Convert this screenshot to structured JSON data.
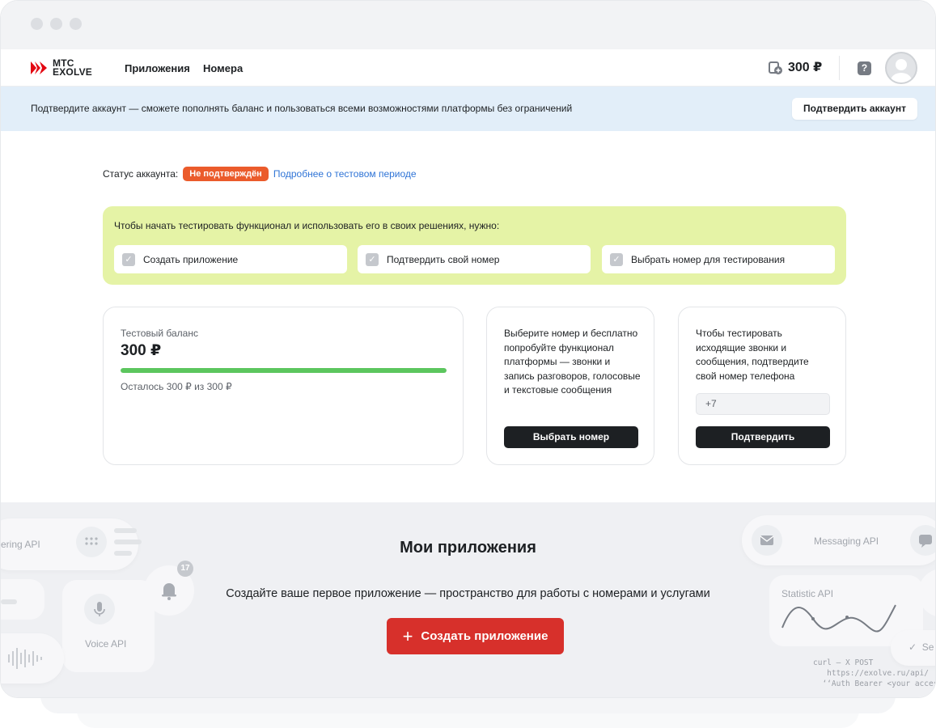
{
  "header": {
    "logo_line1": "МТС",
    "logo_line2": "EXOLVE",
    "nav": [
      "Приложения",
      "Номера"
    ],
    "balance": "300 ₽",
    "help_glyph": "?"
  },
  "banner": {
    "text": "Подтвердите аккаунт — сможете пополнять баланс и пользоваться всеми возможностями платформы без ограничений",
    "button": "Подтвердить аккаунт"
  },
  "status": {
    "label": "Статус аккаунта:",
    "badge": "Не подтверждён",
    "link": "Подробнее о тестовом периоде"
  },
  "onboarding": {
    "title": "Чтобы начать тестировать функционал и использовать его в своих решениях, нужно:",
    "tasks": [
      "Создать приложение",
      "Подтвердить свой номер",
      "Выбрать номер для тестирования"
    ]
  },
  "balance_card": {
    "label": "Тестовый баланс",
    "value": "300 ₽",
    "progress_fraction": 1.0,
    "remaining": "Осталось 300 ₽ из 300 ₽"
  },
  "number_card": {
    "text": "Выберите номер и бесплатно попробуйте функционал платформы — звонки и запись разговоров, голосовые и текстовые сообщения",
    "button": "Выбрать номер"
  },
  "verify_card": {
    "text": "Чтобы тестировать исходящие звонки и сообщения, подтвердите свой номер телефона",
    "input_value": "+7",
    "button": "Подтвердить"
  },
  "apps": {
    "title": "Мои приложения",
    "subtitle": "Создайте ваше первое приложение — пространство для работы с номерами и услугами",
    "create_button": "Создать приложение",
    "plus_glyph": "+"
  },
  "decor": {
    "api_left": "ering API",
    "voice_api": "Voice API",
    "messaging_api": "Messaging API",
    "statistic_api": "Statistic API",
    "notif_count": "17",
    "se_text": "Se",
    "curl_line1": "curl – X POST",
    "curl_line2": "   https://exolve.ru/api/",
    "curl_line3": "  ‘‘Auth Bearer <your access"
  },
  "colors": {
    "accent_red": "#d7302b",
    "badge_orange": "#eb5b2b",
    "banner_blue": "#e2eef9",
    "onboarding_green": "#e5f3a6",
    "progress_green": "#5cc65e",
    "link_blue": "#2f74d6"
  }
}
